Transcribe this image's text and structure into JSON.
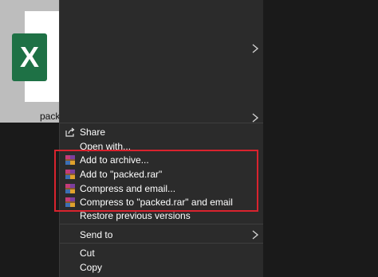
{
  "file": {
    "name": "packed",
    "app_icon_letter": "X",
    "app_icon": "excel-file-icon",
    "accent": "#1e7145"
  },
  "menu": {
    "share": {
      "label": "Share",
      "icon": "share-icon"
    },
    "open_with": {
      "label": "Open with..."
    },
    "winrar_items": [
      {
        "label": "Add to archive...",
        "icon": "winrar-icon"
      },
      {
        "label": "Add to \"packed.rar\"",
        "icon": "winrar-icon"
      },
      {
        "label": "Compress and email...",
        "icon": "winrar-icon"
      },
      {
        "label": "Compress to \"packed.rar\" and email",
        "icon": "winrar-icon"
      }
    ],
    "restore": {
      "label": "Restore previous versions"
    },
    "send_to": {
      "label": "Send to"
    },
    "cut": {
      "label": "Cut"
    },
    "copy": {
      "label": "Copy"
    }
  },
  "colors": {
    "menu_bg": "#2b2b2b",
    "highlight_border": "#d9232e"
  }
}
